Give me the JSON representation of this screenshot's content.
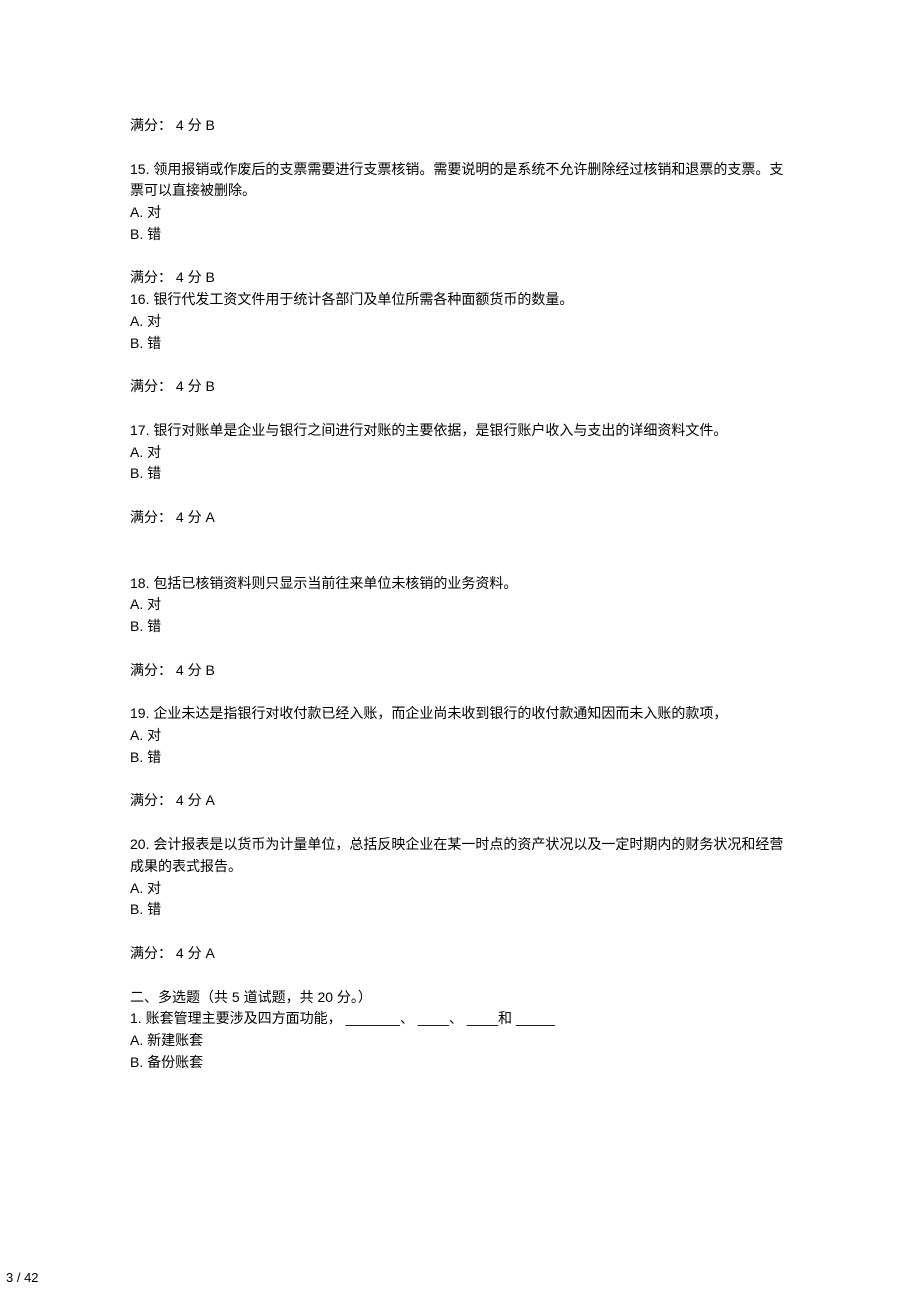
{
  "score_top": " 满分： 4 分 B",
  "q15": {
    "num": "15.",
    "text": "   领用报销或作废后的支票需要进行支票核销。需要说明的是系统不允许删除经过核销和退票的支票。支票可以直接被删除。",
    "a": "A.  对",
    "b": "B.  错",
    "score": "满分： 4 分 B"
  },
  "q16": {
    "num": "16.",
    "text": "   银行代发工资文件用于统计各部门及单位所需各种面额货币的数量。",
    "a": "A.  对",
    "b": "B.  错",
    "score": "满分： 4 分 B"
  },
  "q17": {
    "num": "17.",
    "text": "   银行对账单是企业与银行之间进行对账的主要依据，是银行账户收入与支出的详细资料文件。",
    "a": "A.  对",
    "b": "B.  错",
    "score": " 满分： 4 分 A"
  },
  "q18": {
    "num": "18.",
    "text": "   包括已核销资料则只显示当前往来单位未核销的业务资料。",
    "a": "A.  对",
    "b": "B.  错",
    "score": " 满分： 4 分 B"
  },
  "q19": {
    "num": "19.",
    "text": "   企业未达是指银行对收付款已经入账，而企业尚未收到银行的收付款通知因而未入账的款项，",
    "a": "A.  对",
    "b": "B.  错",
    "score": "满分： 4 分 A"
  },
  "q20": {
    "num": "20.",
    "text": "   会计报表是以货币为计量单位，总括反映企业在某一时点的资产状况以及一定时期内的财务状况和经营成果的表式报告。",
    "a": "A.  对",
    "b": "B.  错",
    "score": "满分： 4 分 A"
  },
  "section2_title": "二、多选题（共 5 道试题，共 20 分。）",
  "mq1": {
    "num": "1.",
    "text": "  账套管理主要涉及四方面功能，  _______、  ____、  ____和 _____",
    "a": "A. 新建账套",
    "b": "B. 备份账套"
  },
  "page_number": "3 / 42"
}
